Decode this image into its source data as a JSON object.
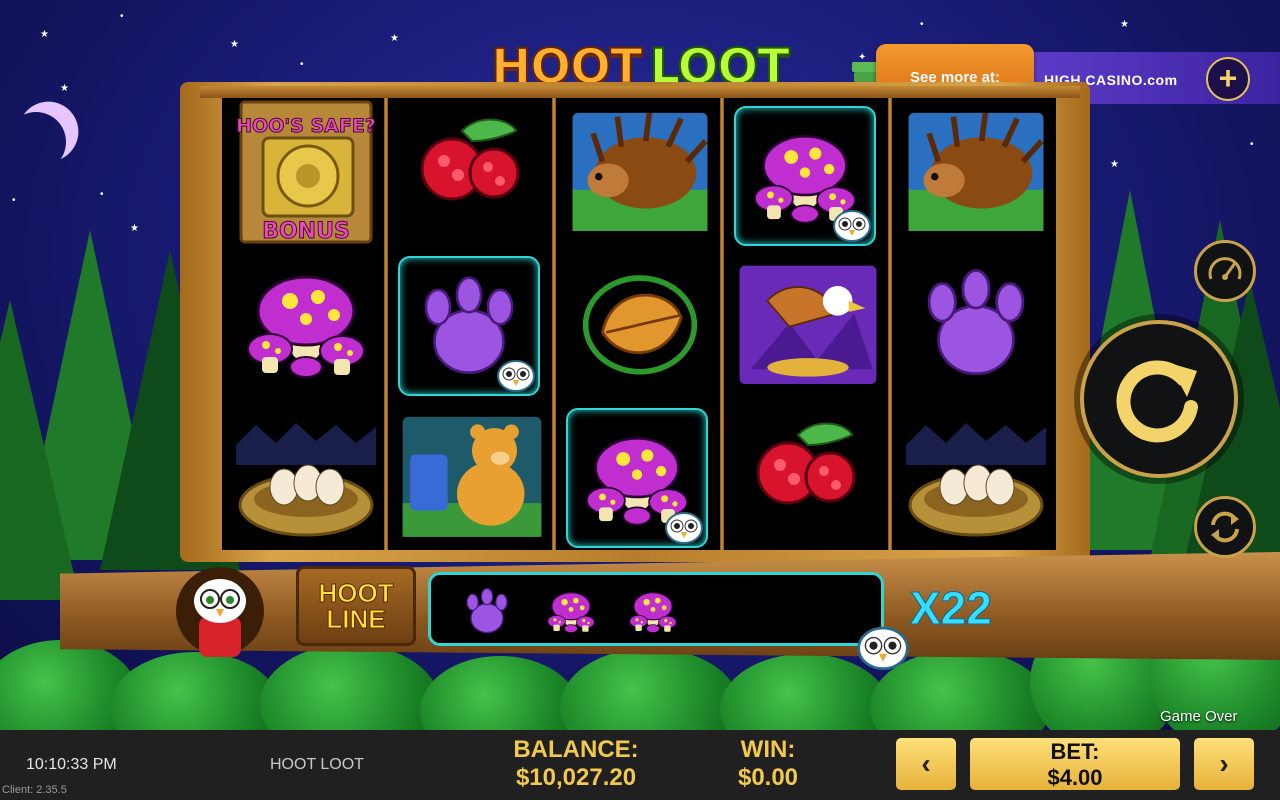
{
  "game": {
    "logo_word1": "HOOT",
    "logo_word2": "LOOT",
    "title": "HOOT LOOT",
    "status": "Game Over"
  },
  "promo": {
    "label": "See more at:",
    "brand": "HIGH CASINO.com",
    "plus": "+"
  },
  "reels": {
    "columns": [
      [
        "hoos-safe-bonus",
        "mushroom",
        "nest"
      ],
      [
        "raspberry",
        "paw-print",
        "bear"
      ],
      [
        "porcupine",
        "leaf",
        "mushroom"
      ],
      [
        "mushroom",
        "eagle",
        "raspberry"
      ],
      [
        "porcupine",
        "paw-print",
        "nest"
      ]
    ],
    "bonus_text_top": "HOO'S SAFE?",
    "bonus_text_bottom": "BONUS"
  },
  "hoot_line": {
    "sign_line1": "HOOT",
    "sign_line2": "LINE",
    "symbols": [
      "paw-print",
      "mushroom",
      "mushroom"
    ],
    "multiplier": "X22"
  },
  "controls": {
    "spin": "spin-icon",
    "speed": "speedometer-icon",
    "autoplay": "autoplay-icon",
    "prev": "‹",
    "next": "›"
  },
  "bottom_bar": {
    "time": "10:10:33 PM",
    "client_version": "Client: 2.35.5",
    "game_name": "HOOT LOOT",
    "balance_label": "BALANCE:",
    "balance_value": "$10,027.20",
    "win_label": "WIN:",
    "win_value": "$0.00",
    "bet_label": "BET:",
    "bet_value": "$4.00"
  },
  "colors": {
    "highlight": "#2fd6d6",
    "gold": "#f2c94c",
    "promo_orange": "#f39a2e",
    "promo_purple": "#5d3cc8"
  }
}
